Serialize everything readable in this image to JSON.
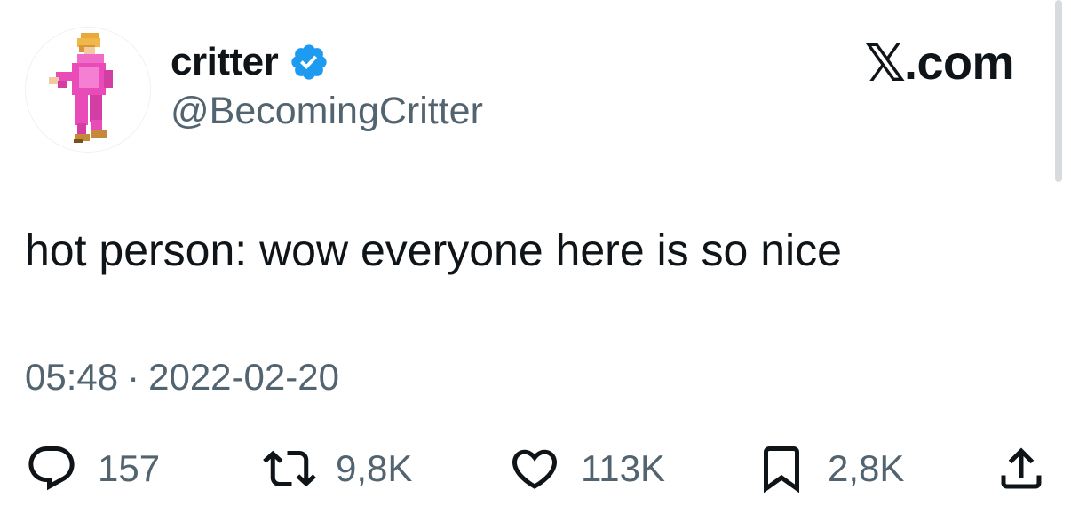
{
  "user": {
    "display_name": "critter",
    "handle": "@BecomingCritter",
    "verified": true,
    "avatar_icon": "pixel-art-figure-in-pink-outfit"
  },
  "site": {
    "x_glyph": "𝕏",
    "suffix": ".com"
  },
  "tweet": {
    "text": "hot person: wow everyone here is so nice",
    "time": "05:48",
    "separator": "·",
    "date": "2022-02-20"
  },
  "actions": {
    "reply": {
      "icon": "reply-icon",
      "count": "157"
    },
    "retweet": {
      "icon": "retweet-icon",
      "count": "9,8K"
    },
    "like": {
      "icon": "heart-icon",
      "count": "113K"
    },
    "bookmark": {
      "icon": "bookmark-icon",
      "count": "2,8K"
    },
    "share": {
      "icon": "share-icon"
    }
  },
  "colors": {
    "text_primary": "#0f1419",
    "text_secondary": "#536471",
    "verified_blue": "#1d9bf0",
    "outfit_pink": "#e94bb8"
  }
}
